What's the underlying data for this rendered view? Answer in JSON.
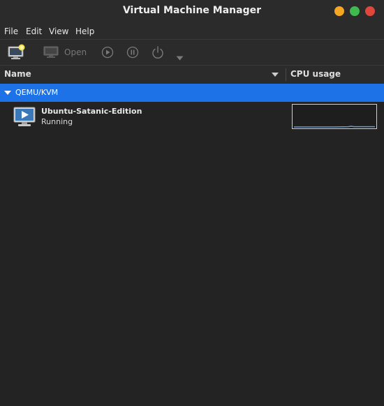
{
  "window": {
    "title": "Virtual Machine Manager",
    "controls": {
      "minimize_color": "#f5a623",
      "maximize_color": "#3fb94f",
      "close_color": "#e0473c"
    }
  },
  "menubar": {
    "items": [
      {
        "label": "File"
      },
      {
        "label": "Edit"
      },
      {
        "label": "View"
      },
      {
        "label": "Help"
      }
    ]
  },
  "toolbar": {
    "new_vm_icon": "new-vm-monitor-star-icon",
    "open_icon": "monitor-icon",
    "open_label": "Open",
    "run_icon": "play-circle-icon",
    "pause_icon": "pause-circle-icon",
    "shutdown_icon": "power-icon",
    "shutdown_menu_icon": "chevron-down-icon"
  },
  "columns": {
    "name": "Name",
    "cpu": "CPU usage"
  },
  "connection": {
    "label": "QEMU/KVM",
    "highlight_color": "#1d72e8"
  },
  "vms": [
    {
      "name": "Ubuntu-Satanic-Edition",
      "status": "Running",
      "icon": "vm-running-monitor-icon"
    }
  ]
}
